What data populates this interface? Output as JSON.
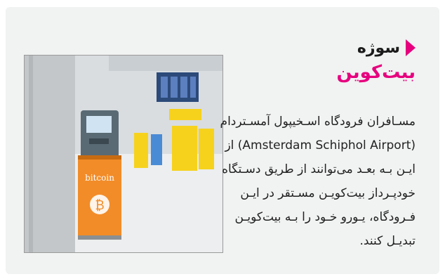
{
  "section": {
    "label": "سوژه"
  },
  "title": "بیت‌کوین",
  "body_lines": [
    "مسـافران فرودگاه اسـخیپول آمسـتردام",
    "(Amsterdam Schiphol Airport) از",
    "ایـن بـه بعـد می‌توانند از طریق دسـتگاه",
    "خودپـرداز بیت‌کویـن مسـتقر در ایـن",
    "فـرودگاه، یـورو خـود را بـه بیت‌کویـن",
    "تبدیـل کنند."
  ],
  "photo": {
    "kiosk_text": "bitcoin",
    "symbol": "₿"
  },
  "colors": {
    "accent": "#e6007e",
    "card_bg": "#f1f2f2",
    "kiosk_orange": "#f28c28"
  }
}
